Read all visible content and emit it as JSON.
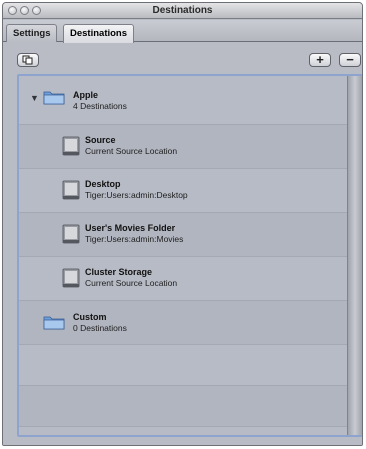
{
  "window": {
    "title": "Destinations"
  },
  "tabs": [
    {
      "label": "Settings",
      "active": false
    },
    {
      "label": "Destinations",
      "active": true
    }
  ],
  "toolbar": {
    "duplicate_icon": "duplicate-icon",
    "add_label": "+",
    "remove_label": "−"
  },
  "groups": [
    {
      "name": "Apple",
      "count_text": "4 Destinations",
      "expanded": true,
      "items": [
        {
          "name": "Source",
          "location": "Current Source Location"
        },
        {
          "name": "Desktop",
          "location": "Tiger:Users:admin:Desktop"
        },
        {
          "name": "User's Movies Folder",
          "location": "Tiger:Users:admin:Movies"
        },
        {
          "name": "Cluster Storage",
          "location": "Current Source Location"
        }
      ]
    },
    {
      "name": "Custom",
      "count_text": "0 Destinations",
      "expanded": false,
      "items": []
    }
  ],
  "colors": {
    "selection_border": "#8fa3cf",
    "folder_blue": "#6f9fd8",
    "panel_bg": "#b8bcc4"
  }
}
